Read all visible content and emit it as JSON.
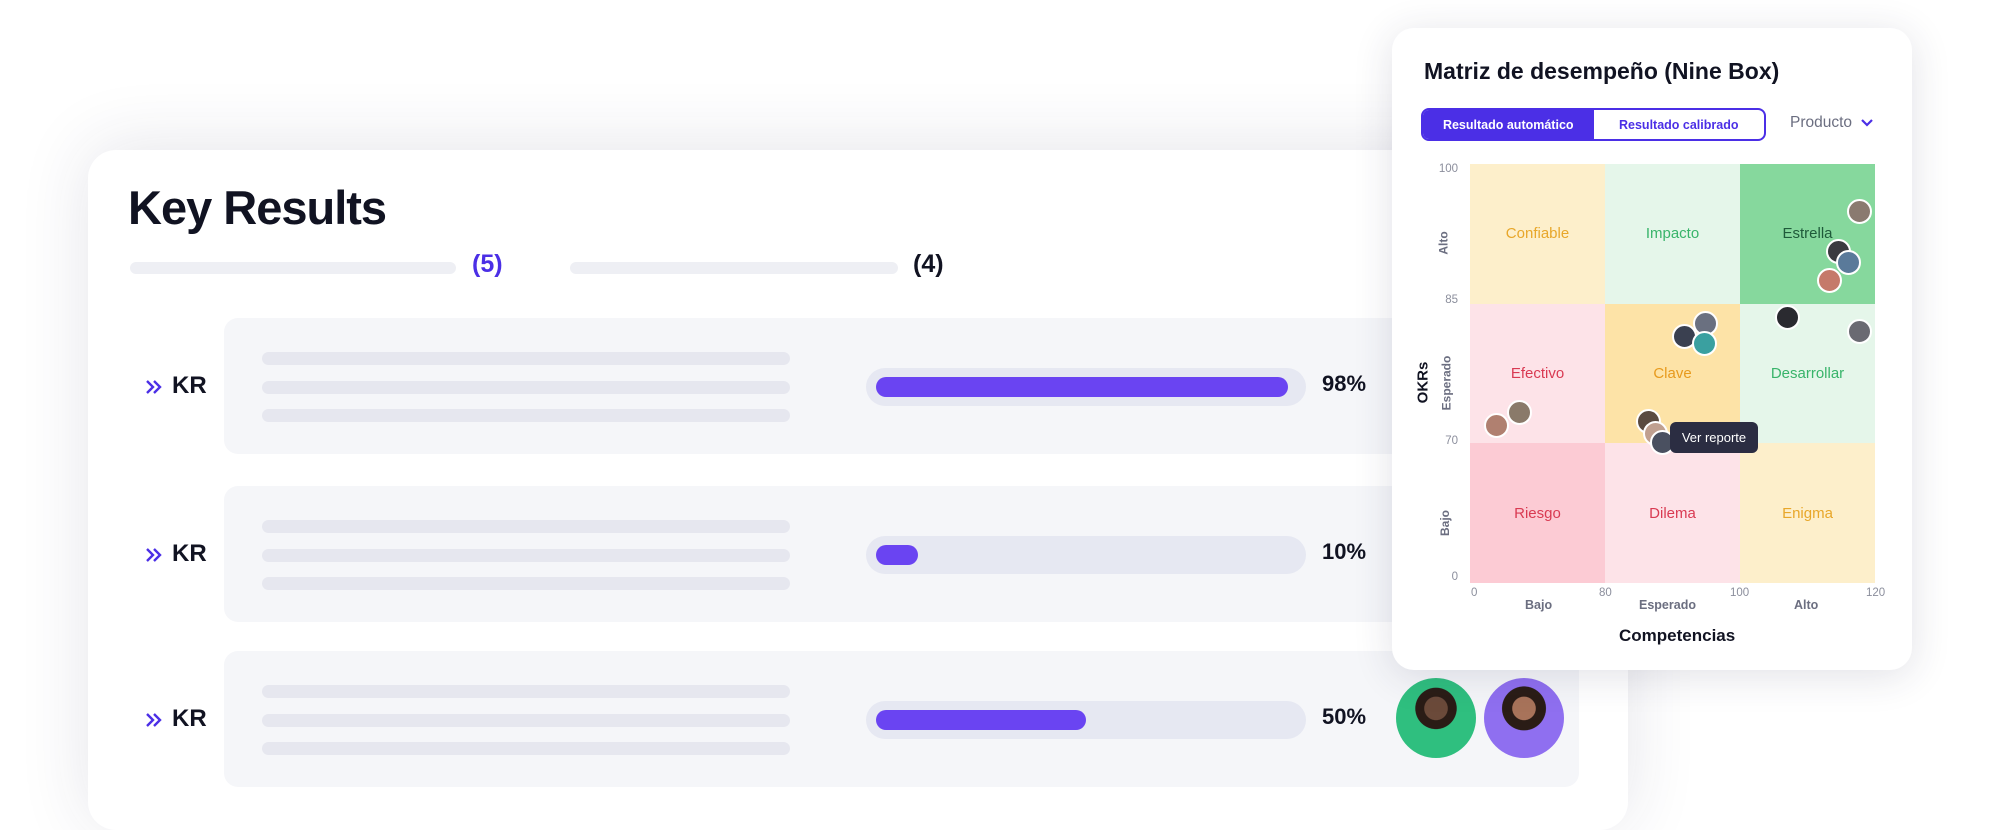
{
  "key_results": {
    "title": "Key Results",
    "count_a": "(5)",
    "count_b": "(4)",
    "rows": [
      {
        "label": "KR",
        "progress": 98,
        "percent_label": "98%"
      },
      {
        "label": "KR",
        "progress": 10,
        "percent_label": "10%"
      },
      {
        "label": "KR",
        "progress": 50,
        "percent_label": "50%"
      }
    ],
    "colors": {
      "accent": "#4b2fe6",
      "bar": "#6a44f2",
      "track": "#e6e8f2"
    }
  },
  "nine_box": {
    "title": "Matriz de desempeño (Nine Box)",
    "tabs": [
      {
        "label": "Resultado automático",
        "active": true
      },
      {
        "label": "Resultado calibrado",
        "active": false
      }
    ],
    "filter": {
      "label": "Producto",
      "icon": "chevron-down-icon"
    },
    "y_axis": {
      "title": "OKRs",
      "ticks": [
        "100",
        "85",
        "70",
        "0"
      ],
      "levels": [
        "Alto",
        "Esperado",
        "Bajo"
      ]
    },
    "x_axis": {
      "title": "Competencias",
      "ticks": [
        "0",
        "80",
        "100",
        "120"
      ],
      "levels": [
        "Bajo",
        "Esperado",
        "Alto"
      ]
    },
    "cells": [
      {
        "label": "Confiable",
        "color": "#fdefcb",
        "text_color": "#e8a72a"
      },
      {
        "label": "Impacto",
        "color": "#e5f6ea",
        "text_color": "#38b46a"
      },
      {
        "label": "Estrella",
        "color": "#86d89d",
        "text_color": "#1f5a3a"
      },
      {
        "label": "Efectivo",
        "color": "#fde3e8",
        "text_color": "#d93a52"
      },
      {
        "label": "Clave",
        "color": "#fde3a7",
        "text_color": "#e79a1d"
      },
      {
        "label": "Desarrollar",
        "color": "#e5f6ea",
        "text_color": "#38b46a"
      },
      {
        "label": "Riesgo",
        "color": "#fccbd4",
        "text_color": "#d93a52"
      },
      {
        "label": "Dilema",
        "color": "#fde3e8",
        "text_color": "#d93a52"
      },
      {
        "label": "Enigma",
        "color": "#fdefcb",
        "text_color": "#e8a72a"
      }
    ],
    "tooltip": "Ver reporte"
  }
}
